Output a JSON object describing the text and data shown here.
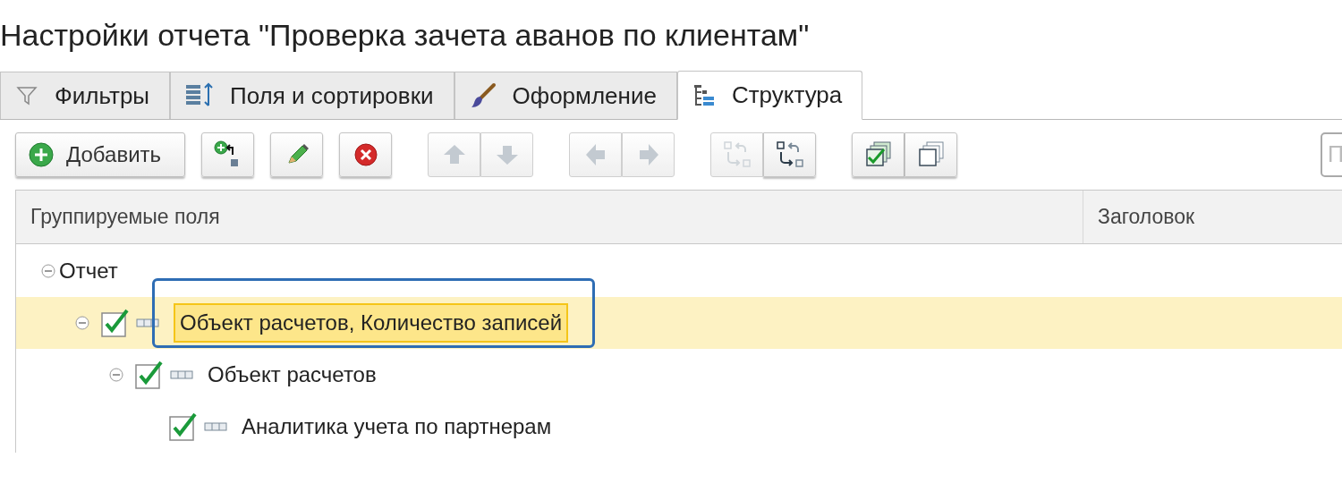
{
  "window": {
    "title": "Настройки отчета \"Проверка зачета аванов по клиентам\""
  },
  "tabs": [
    {
      "label": "Фильтры",
      "kind": "filter",
      "selected": false
    },
    {
      "label": "Поля и сортировки",
      "kind": "fields",
      "selected": false
    },
    {
      "label": "Оформление",
      "kind": "brush",
      "selected": false
    },
    {
      "label": "Структура",
      "kind": "structure",
      "selected": true
    }
  ],
  "toolbar": {
    "add_button": {
      "label": "Добавить"
    },
    "groups": [
      {
        "buttons": [
          {
            "kind": "add-nested",
            "disabled": false
          }
        ]
      },
      {
        "buttons": [
          {
            "kind": "edit",
            "disabled": false
          }
        ]
      },
      {
        "buttons": [
          {
            "kind": "delete",
            "disabled": false
          }
        ]
      },
      {
        "buttons": [
          {
            "kind": "up",
            "disabled": true
          },
          {
            "kind": "down",
            "disabled": true
          }
        ]
      },
      {
        "buttons": [
          {
            "kind": "left",
            "disabled": true
          },
          {
            "kind": "right",
            "disabled": true
          }
        ]
      },
      {
        "buttons": [
          {
            "kind": "swap-up",
            "disabled": true
          },
          {
            "kind": "swap-down",
            "disabled": false
          }
        ]
      },
      {
        "buttons": [
          {
            "kind": "check-all",
            "disabled": false
          },
          {
            "kind": "uncheck-all",
            "disabled": false
          }
        ]
      }
    ],
    "search_field": {
      "placeholder": "П"
    }
  },
  "table": {
    "columns": [
      "Группируемые поля",
      "Заголовок"
    ],
    "tree": [
      {
        "label": "Отчет",
        "kind": "root",
        "expanded": true,
        "selected": false,
        "annotated": false,
        "children": [
          {
            "label": "Объект расчетов, Количество записей",
            "kind": "field",
            "checked": true,
            "expanded": true,
            "selected": true,
            "annotated": true,
            "children": [
              {
                "label": "Объект расчетов",
                "kind": "field",
                "checked": true,
                "expanded": true,
                "selected": false,
                "annotated": false,
                "children": [
                  {
                    "label": "Аналитика учета по партнерам",
                    "kind": "field",
                    "checked": true,
                    "selected": false,
                    "annotated": false
                  }
                ]
              }
            ]
          }
        ]
      }
    ]
  }
}
